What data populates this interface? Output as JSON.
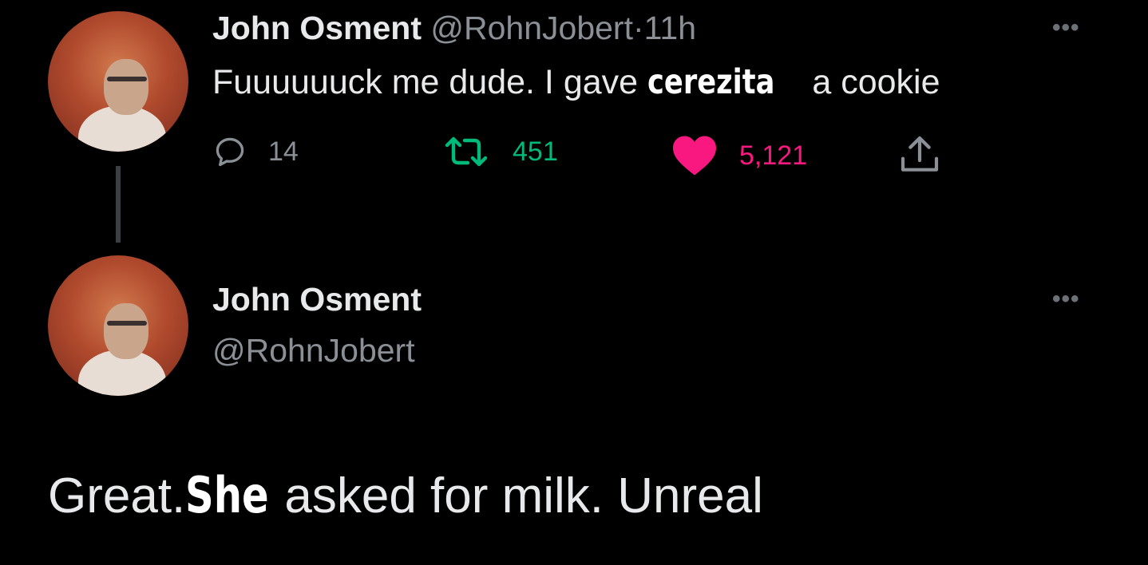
{
  "tweet": {
    "display_name": "John Osment",
    "handle": "@RohnJobert",
    "separator": "·",
    "time": "11h",
    "text_before": "Fuuuuuuck me dude. I gave ",
    "text_overlay": "cerezita",
    "text_after": " a cookie",
    "more_label": "•••",
    "actions": {
      "replies": "14",
      "retweets": "451",
      "likes": "5,121"
    },
    "colors": {
      "retweet": "#00ba7c",
      "like": "#f91880",
      "muted": "#8a9096"
    }
  },
  "reply": {
    "display_name": "John Osment",
    "handle": "@RohnJobert",
    "more_label": "•••",
    "text_before": "Great.",
    "text_overlay": "She",
    "text_after": " asked for milk. Unreal"
  }
}
